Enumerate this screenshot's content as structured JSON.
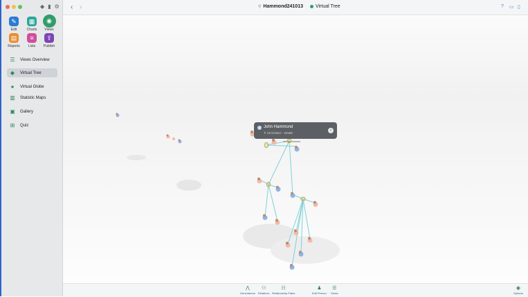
{
  "window": {
    "document_name": "Hammond241013",
    "view_name": "Virtual Tree"
  },
  "toolbar": [
    {
      "label": "Edit",
      "icon": "pencil-icon",
      "color": "#2b7bd4"
    },
    {
      "label": "Charts",
      "icon": "charts-icon",
      "color": "#2aa79a"
    },
    {
      "label": "Views",
      "icon": "eye-icon",
      "color": "#2f9d6a"
    },
    {
      "label": "Reports",
      "icon": "reports-icon",
      "color": "#e88c2e"
    },
    {
      "label": "Lists",
      "icon": "list-icon",
      "color": "#d04e9c"
    },
    {
      "label": "Publish",
      "icon": "publish-icon",
      "color": "#7c45b6"
    }
  ],
  "sidebar": {
    "items": [
      {
        "label": "Views Overview",
        "icon": "list-lines-icon",
        "active": false
      },
      {
        "label": "Virtual Tree",
        "icon": "tree-cube-icon",
        "active": true
      },
      {
        "label": "Virtual Globe",
        "icon": "globe-icon",
        "active": false
      },
      {
        "label": "Statistic Maps",
        "icon": "map-icon",
        "active": false
      },
      {
        "label": "Gallery",
        "icon": "gallery-icon",
        "active": false
      },
      {
        "label": "Quiz",
        "icon": "quiz-icon",
        "active": false
      }
    ]
  },
  "popup": {
    "name": "John Hammond",
    "dates": "✝ 21/1/1842 – Death"
  },
  "bottombar": {
    "items": [
      {
        "label": "Generations",
        "icon": "generations-icon"
      },
      {
        "label": "Relatives",
        "icon": "relatives-icon"
      },
      {
        "label": "Relationship Paths",
        "icon": "paths-icon"
      },
      {
        "label": "Edit Person",
        "icon": "person-icon"
      },
      {
        "label": "Views",
        "icon": "views-icon"
      },
      {
        "label": "Options",
        "icon": "options-icon"
      }
    ]
  },
  "colors": {
    "accent": "#2f9d6a",
    "link_line": "#7fd0d6",
    "male": "#8fb3e8",
    "female": "#f2b9a6"
  }
}
